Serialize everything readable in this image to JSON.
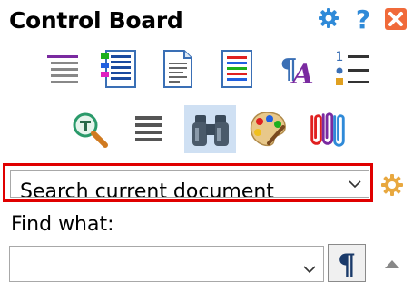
{
  "panel": {
    "title": "Control Board"
  },
  "header_icons": [
    "settings-gear-icon",
    "help-question-icon",
    "close-x-icon"
  ],
  "toolbar_row1": [
    "paragraph-lines-icon",
    "colored-list-icon",
    "document-text-icon",
    "colored-document-icon",
    "pilcrow-font-icon",
    "numbered-list-icon"
  ],
  "toolbar_row2": [
    "magnifier-icon",
    "justify-lines-icon",
    "binoculars-icon",
    "palette-icon",
    "paperclips-icon"
  ],
  "search": {
    "mode_text": "Search current document",
    "find_label": "Find what:",
    "find_value": ""
  },
  "colors": {
    "accent_blue": "#2f8ad8",
    "close_orange": "#f06a3a",
    "highlight_red": "#e00000",
    "active_button_bg": "#cfe0f3"
  }
}
